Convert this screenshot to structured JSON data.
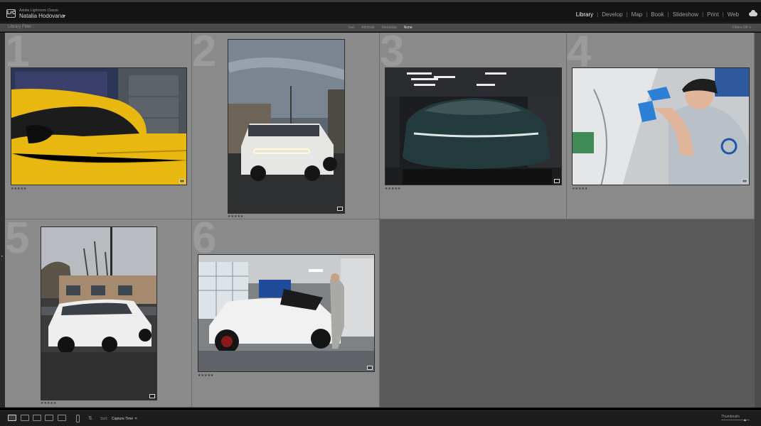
{
  "app": {
    "subtitle": "Adobe Lightroom Classic",
    "logo_text": "LrC",
    "user_name": "Natalia Hodovana",
    "caret": "▾"
  },
  "modules": [
    "Library",
    "Develop",
    "Map",
    "Book",
    "Slideshow",
    "Print",
    "Web"
  ],
  "active_module": "Library",
  "filter_bar": {
    "title": "Library Filter :",
    "tabs": [
      "Text",
      "Attribute",
      "Metadata",
      "None"
    ],
    "active_tab": "None",
    "filters_off": "Filters Off ≎"
  },
  "grid": {
    "cells": [
      {
        "number": "1",
        "stars": "★★★★★",
        "photo": "Yellow sports car close-up by garage door",
        "icon": "expand-icon"
      },
      {
        "number": "2",
        "stars": "★★★★★",
        "photo": "White Rivian truck under cloudy sky",
        "icon": "edit-badge-icon"
      },
      {
        "number": "3",
        "stars": "★★★★★",
        "photo": "Dark teal electric sedan in studio garage",
        "icon": "edit-badge-icon"
      },
      {
        "number": "4",
        "stars": "★★★★★",
        "photo": "Technician applying paint protection film",
        "icon": "expand-icon"
      },
      {
        "number": "5",
        "stars": "★★★★★",
        "photo": "White Porsche Cayenne in parking lot",
        "icon": "edit-badge-icon"
      },
      {
        "number": "6",
        "stars": "★★★★★",
        "photo": "White Porsche Cayenne in detailing shop",
        "icon": "edit-badge-icon"
      }
    ]
  },
  "toolbar": {
    "sort_label": "Sort:",
    "sort_value": "Capture Time",
    "sort_caret": "≑",
    "thumbnails_label": "Thumbnails"
  },
  "colors": {
    "cell_bg": "#8a8a8a",
    "grid_bg": "#5a5a5a",
    "topbar_bg": "#141414",
    "active_text": "#f2f2f2"
  }
}
